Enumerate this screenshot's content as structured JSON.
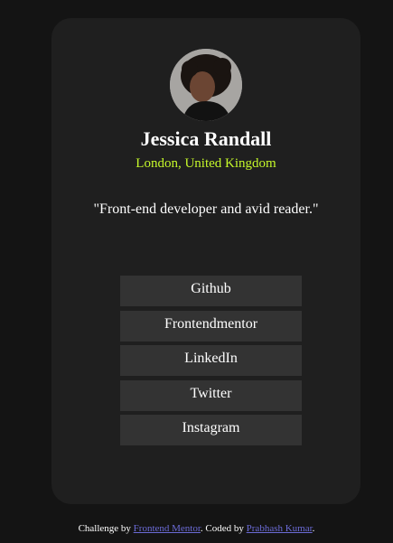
{
  "profile": {
    "name": "Jessica Randall",
    "location": "London, United Kingdom",
    "bio": "\"Front-end developer and avid reader.\""
  },
  "links": [
    {
      "label": "Github"
    },
    {
      "label": "Frontendmentor"
    },
    {
      "label": "LinkedIn"
    },
    {
      "label": "Twitter"
    },
    {
      "label": "Instagram"
    }
  ],
  "footer": {
    "prefix": "Challenge by ",
    "link1": "Frontend Mentor",
    "middle": ". Coded by ",
    "link2": "Prabhash Kumar",
    "suffix": "."
  },
  "colors": {
    "background": "#141414",
    "card": "#1f1f1f",
    "button": "#333333",
    "accent": "#c5f82a",
    "footer_link": "#6b6bd6"
  }
}
